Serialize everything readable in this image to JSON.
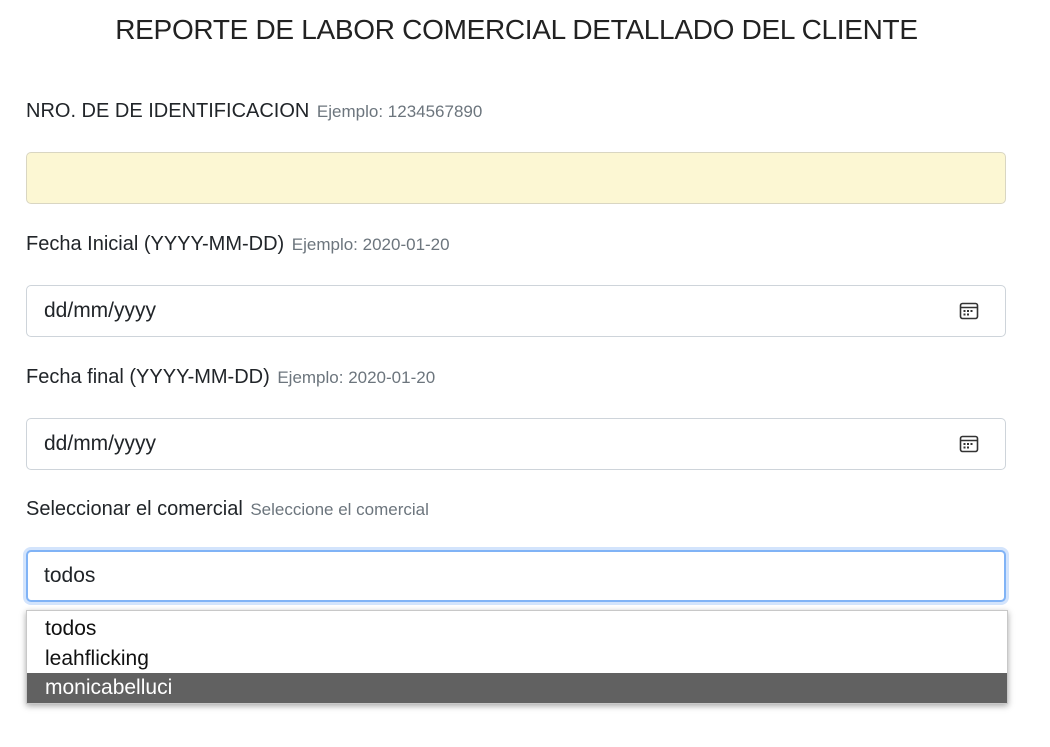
{
  "page": {
    "title": "REPORTE DE LABOR COMERCIAL DETALLADO DEL CLIENTE"
  },
  "id_field": {
    "label": "NRO. DE DE IDENTIFICACION",
    "hint": "Ejemplo: 1234567890",
    "value": ""
  },
  "start_date": {
    "label": "Fecha Inicial (YYYY-MM-DD)",
    "hint": "Ejemplo: 2020-01-20",
    "placeholder": "dd/mm/yyyy",
    "icon": "calendar-icon"
  },
  "end_date": {
    "label": "Fecha final (YYYY-MM-DD)",
    "hint": "Ejemplo: 2020-01-20",
    "placeholder": "dd/mm/yyyy",
    "icon": "calendar-icon"
  },
  "commercial_select": {
    "label": "Seleccionar el comercial",
    "hint": "Seleccione el comercial",
    "selected": "todos",
    "options": [
      "todos",
      "leahflicking",
      "monicabelluci"
    ],
    "highlighted_option": "monicabelluci"
  },
  "colors": {
    "id_field_bg": "#fcf7d3",
    "focus_ring": "#80b3f6",
    "highlight_bg": "#616161"
  }
}
